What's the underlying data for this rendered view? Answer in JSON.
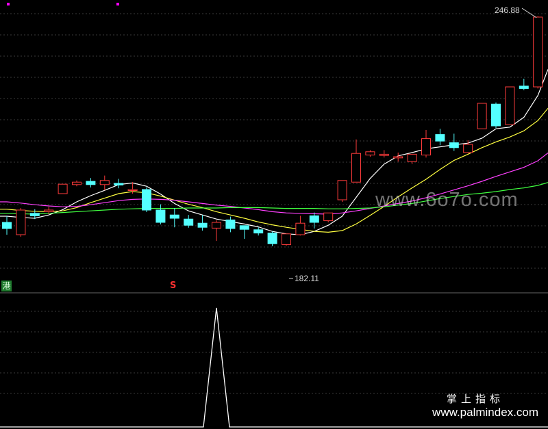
{
  "market_tag": "港",
  "signal_tag": "S",
  "watermark": "www.6o7o.com",
  "brand": {
    "cn": "掌上指标",
    "url": "www.palmindex.com"
  },
  "colors": {
    "background": "#000000",
    "grid": "#3a3a3a",
    "up": "#ff3b3b",
    "down": "#54ffff",
    "ma_white": "#ffffff",
    "ma_yellow": "#ffff40",
    "ma_magenta": "#ff40ff",
    "ma_green": "#40ff40"
  },
  "chart_data": {
    "type": "candlestick",
    "high_label": "246.88",
    "low_label": "182.11",
    "candles": [
      {
        "o": 196.0,
        "h": 197.5,
        "c": 194.5,
        "l": 193.0
      },
      {
        "o": 193.0,
        "h": 199.5,
        "c": 199.0,
        "l": 192.5
      },
      {
        "o": 198.2,
        "h": 199.2,
        "c": 197.6,
        "l": 196.8
      },
      {
        "o": 198.6,
        "h": 199.8,
        "c": 199.0,
        "l": 198.0
      },
      {
        "o": 203.0,
        "h": 205.0,
        "c": 205.3,
        "l": 203.0
      },
      {
        "o": 205.2,
        "h": 206.2,
        "c": 205.8,
        "l": 204.8
      },
      {
        "o": 206.0,
        "h": 206.8,
        "c": 205.2,
        "l": 204.5
      },
      {
        "o": 205.2,
        "h": 207.4,
        "c": 206.2,
        "l": 203.8
      },
      {
        "o": 205.5,
        "h": 206.6,
        "c": 205.1,
        "l": 204.3
      },
      {
        "o": 204.0,
        "h": 205.8,
        "c": 204.0,
        "l": 203.0
      },
      {
        "o": 204.0,
        "h": 204.5,
        "c": 199.0,
        "l": 198.5
      },
      {
        "o": 199.0,
        "h": 200.4,
        "c": 196.0,
        "l": 195.5
      },
      {
        "o": 197.8,
        "h": 199.5,
        "c": 197.0,
        "l": 194.8
      },
      {
        "o": 196.8,
        "h": 197.8,
        "c": 195.3,
        "l": 194.7
      },
      {
        "o": 195.8,
        "h": 197.8,
        "c": 194.8,
        "l": 194.0
      },
      {
        "o": 194.6,
        "h": 196.5,
        "c": 196.0,
        "l": 191.5
      },
      {
        "o": 196.6,
        "h": 197.4,
        "c": 194.5,
        "l": 193.6
      },
      {
        "o": 195.2,
        "h": 195.2,
        "c": 194.3,
        "l": 192.0
      },
      {
        "o": 194.2,
        "h": 194.8,
        "c": 193.4,
        "l": 192.8
      },
      {
        "o": 193.4,
        "h": 193.8,
        "c": 190.8,
        "l": 190.2
      },
      {
        "o": 190.6,
        "h": 193.0,
        "c": 193.2,
        "l": 190.3
      },
      {
        "o": 193.0,
        "h": 197.6,
        "c": 195.8,
        "l": 192.8
      },
      {
        "o": 197.6,
        "h": 198.4,
        "c": 196.0,
        "l": 194.5
      },
      {
        "o": 196.4,
        "h": 197.8,
        "c": 198.3,
        "l": 196.0
      },
      {
        "o": 201.5,
        "h": 205.8,
        "c": 206.2,
        "l": 201.0
      },
      {
        "o": 205.8,
        "h": 216.2,
        "c": 212.8,
        "l": 205.8
      },
      {
        "o": 212.4,
        "h": 213.6,
        "c": 213.2,
        "l": 212.0
      },
      {
        "o": 212.3,
        "h": 213.6,
        "c": 212.6,
        "l": 211.8
      },
      {
        "o": 211.7,
        "h": 213.0,
        "c": 212.0,
        "l": 210.8
      },
      {
        "o": 210.8,
        "h": 212.4,
        "c": 212.6,
        "l": 210.2
      },
      {
        "o": 212.4,
        "h": 218.5,
        "c": 216.4,
        "l": 211.8
      },
      {
        "o": 217.4,
        "h": 218.8,
        "c": 215.8,
        "l": 214.8
      },
      {
        "o": 215.4,
        "h": 217.6,
        "c": 214.2,
        "l": 213.4
      },
      {
        "o": 213.0,
        "h": 216.0,
        "c": 215.0,
        "l": 212.8
      },
      {
        "o": 218.8,
        "h": 224.2,
        "c": 225.0,
        "l": 218.8
      },
      {
        "o": 224.8,
        "h": 225.2,
        "c": 219.5,
        "l": 219.0
      },
      {
        "o": 219.8,
        "h": 229.0,
        "c": 229.0,
        "l": 219.8
      },
      {
        "o": 229.2,
        "h": 231.0,
        "c": 228.6,
        "l": 228.2
      },
      {
        "o": 229.0,
        "h": 246.2,
        "c": 246.0,
        "l": 228.6
      }
    ],
    "moving_averages": [
      {
        "name": "MA5",
        "values": [
          197.5,
          197.2,
          197.0,
          197.8,
          199.1,
          201.0,
          202.5,
          203.8,
          205.2,
          205.6,
          204.8,
          202.9,
          200.6,
          198.8,
          197.8,
          196.8,
          196.2,
          195.6,
          194.9,
          193.8,
          193.2,
          193.0,
          193.8,
          195.3,
          197.5,
          202.1,
          206.7,
          210.2,
          212.2,
          213.0,
          213.9,
          214.4,
          214.9,
          215.3,
          216.5,
          218.8,
          219.2,
          221.6,
          226.9
        ]
      },
      {
        "name": "MA10",
        "values": [
          199.2,
          198.9,
          198.7,
          198.6,
          198.8,
          199.6,
          200.8,
          201.9,
          203.0,
          203.5,
          203.2,
          202.4,
          201.4,
          200.4,
          199.6,
          198.6,
          197.8,
          197.0,
          196.1,
          195.4,
          194.8,
          194.3,
          193.8,
          193.6,
          194.0,
          195.6,
          197.7,
          199.9,
          202.2,
          204.4,
          206.5,
          208.9,
          211.1,
          212.6,
          214.2,
          215.6,
          216.8,
          218.3,
          220.8
        ]
      },
      {
        "name": "MA20",
        "values": [
          201.0,
          200.7,
          200.3,
          200.0,
          199.8,
          199.9,
          200.3,
          200.8,
          201.3,
          201.6,
          201.7,
          201.6,
          201.4,
          201.0,
          200.6,
          200.2,
          199.9,
          199.5,
          199.1,
          198.6,
          198.3,
          198.2,
          198.1,
          198.0,
          198.3,
          198.8,
          199.4,
          200.0,
          200.6,
          201.2,
          202.0,
          202.9,
          203.9,
          204.9,
          206.0,
          207.2,
          208.3,
          209.4,
          211.0
        ]
      },
      {
        "name": "MA60",
        "values": [
          198.2,
          198.1,
          198.0,
          198.2,
          198.4,
          198.6,
          198.8,
          199.0,
          199.2,
          199.3,
          199.4,
          199.4,
          199.4,
          199.5,
          199.5,
          199.5,
          199.6,
          199.6,
          199.6,
          199.5,
          199.4,
          199.4,
          199.4,
          199.3,
          199.3,
          199.4,
          199.5,
          199.8,
          200.2,
          200.6,
          201.2,
          201.8,
          202.3,
          202.8,
          203.1,
          203.5,
          204.0,
          204.4,
          205.0
        ]
      }
    ],
    "indicator": {
      "values": [
        0,
        0,
        0,
        0,
        0,
        0,
        0,
        0,
        0,
        0,
        0,
        0,
        0,
        0,
        0,
        1,
        0,
        0,
        0,
        0,
        0,
        0,
        0,
        0,
        0,
        0,
        0,
        0,
        0,
        0,
        0,
        0,
        0,
        0,
        0,
        0,
        0,
        0,
        0
      ],
      "ylim": [
        0,
        1
      ]
    },
    "ylim": [
      181,
      248.5
    ]
  }
}
